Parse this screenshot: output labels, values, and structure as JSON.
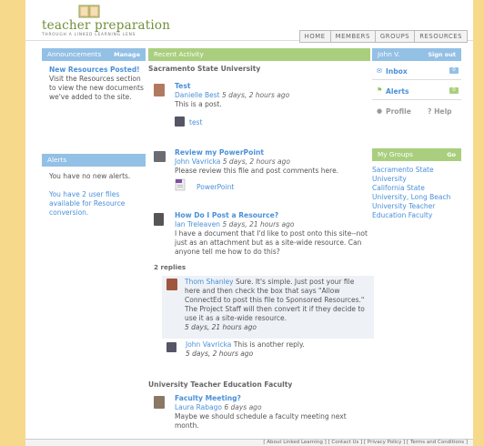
{
  "logo": {
    "title": "teacher preparation",
    "subtitle": "THROUGH A LINKED LEARNING LENS"
  },
  "nav": [
    "HOME",
    "MEMBERS",
    "GROUPS",
    "RESOURCES"
  ],
  "announcements": {
    "header": "Announcements",
    "manage": "Manage",
    "lead": "New Resources Posted!",
    "body": "Visit the Resources section to view the new documents we've added to the site."
  },
  "alerts": {
    "header": "Alerts",
    "none": "You have no new alerts.",
    "files": "You have 2 user files available for Resource conversion."
  },
  "activity": {
    "header": "Recent Activity",
    "group1": "Sacramento State University",
    "post1": {
      "title": "Test",
      "name": "Danielle Best",
      "when": "5 days, 2 hours ago",
      "body": "This is a post.",
      "attach": "test"
    },
    "post2": {
      "title": "Review my PowerPoint",
      "name": "John Vavricka",
      "when": "5 days, 2 hours ago",
      "body": "Please review this file and post comments here.",
      "attach": "PowerPoint"
    },
    "post3": {
      "title": "How Do I Post a Resource?",
      "name": "Ian Treleaven",
      "when": "5 days, 21 hours ago",
      "body": "I have a document that I'd like to post onto this site--not just as an attachment but as a site-wide resource. Can anyone tell me how to do this?"
    },
    "replies": "2 replies",
    "reply1": {
      "name": "Thom Shanley",
      "body": "Sure. It's simple. Just post your file here and then check the box that says \"Allow ConnectEd to post this file to Sponsored Resources.\" The Project Staff will then convert it if they decide to use it as a site-wide resource.",
      "when": "5 days, 21 hours ago"
    },
    "reply2": {
      "name": "John Vavricka",
      "body": "This is another reply.",
      "when": "5 days, 2 hours ago"
    },
    "group2": "University Teacher Education Faculty",
    "post4": {
      "title": "Faculty Meeting?",
      "name": "Laura Rabago",
      "when": "6 days ago",
      "body": "Maybe we should schedule a faculty meeting next month."
    }
  },
  "user": {
    "name": "John V.",
    "signout": "Sign out",
    "inbox": "Inbox",
    "inbox_count": "0",
    "alerts": "Alerts",
    "alerts_count": "0",
    "profile": "Profile",
    "help": "Help"
  },
  "groups": {
    "header": "My Groups",
    "go": "Go",
    "items": [
      "Sacramento State University",
      "California State University, Long Beach",
      "University Teacher Education Faculty"
    ]
  },
  "footer": "[ About Linked Learning ] [ Contact Us ] [ Privacy Policy ] [ Terms and Conditions ]",
  "colors": {
    "blue_header": "#93c0e5",
    "green_header": "#a9cf7e",
    "link": "#4a90d9",
    "rail": "#f7d98c"
  }
}
